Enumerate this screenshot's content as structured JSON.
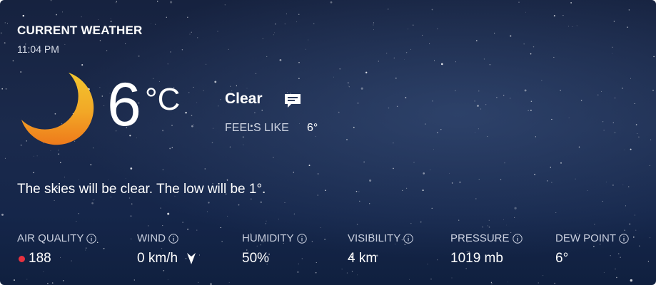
{
  "header": {
    "title": "CURRENT WEATHER",
    "time": "11:04 PM"
  },
  "current": {
    "icon": "moon-icon",
    "temperature": "6",
    "unit": "°C",
    "condition": "Clear",
    "feels_like_label": "FEELS LIKE",
    "feels_like_value": "6°"
  },
  "summary": "The skies will be clear. The low will be 1°.",
  "stats": {
    "air_quality": {
      "label": "AIR QUALITY",
      "value": "188",
      "indicator_color": "#e8313f"
    },
    "wind": {
      "label": "WIND",
      "value": "0 km/h"
    },
    "humidity": {
      "label": "HUMIDITY",
      "value": "50%"
    },
    "visibility": {
      "label": "VISIBILITY",
      "value": "4 km"
    },
    "pressure": {
      "label": "PRESSURE",
      "value": "1019 mb"
    },
    "dew_point": {
      "label": "DEW POINT",
      "value": "6°"
    }
  },
  "colors": {
    "moon_top": "#f2c12e",
    "moon_bottom": "#ef7d1c",
    "background": "#1b2a4c"
  }
}
